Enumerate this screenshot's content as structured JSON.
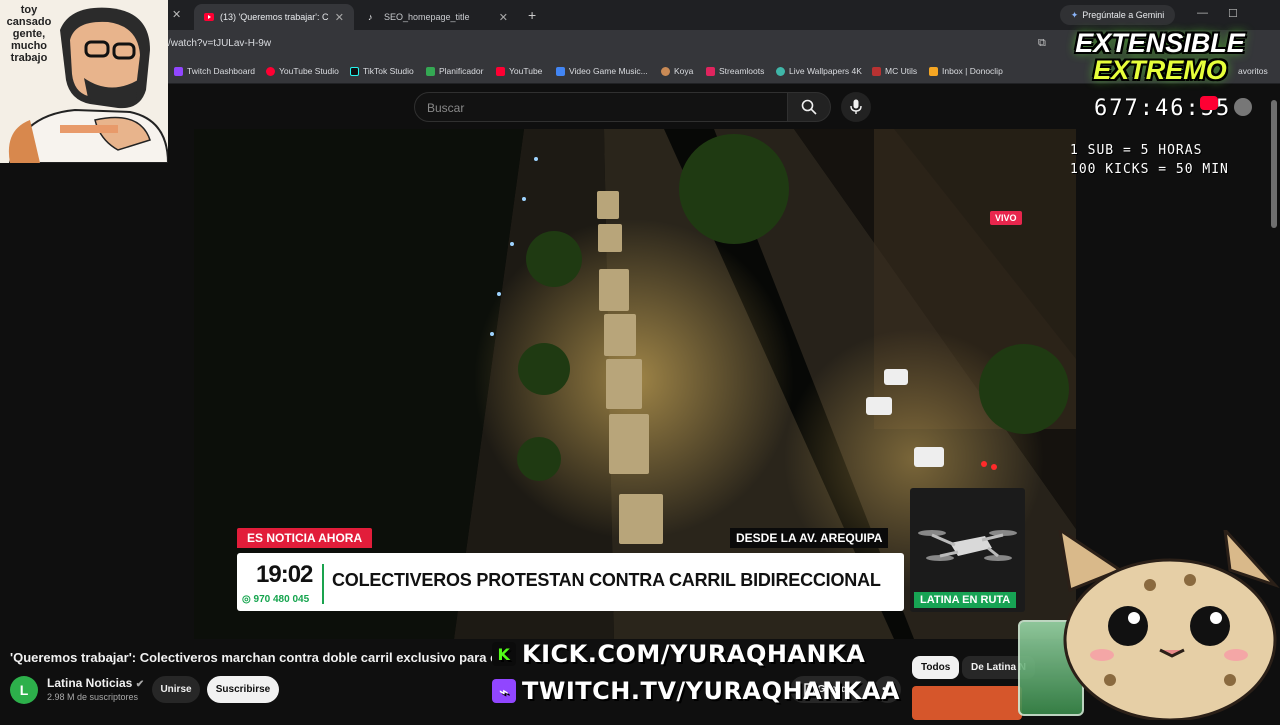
{
  "browser": {
    "tabs": [
      {
        "title": "(13) 'Queremos trabajar': C",
        "active": true
      },
      {
        "title": "SEO_homepage_title",
        "active": false
      }
    ],
    "new_tab": "+",
    "gemini_label": "Pregúntale a Gemini",
    "url": "/watch?v=tJULav-H-9w",
    "bookmarks": [
      "Twitch Dashboard",
      "YouTube Studio",
      "TikTok Studio",
      "Planificador",
      "YouTube",
      "Video Game Music...",
      "Koya",
      "Streamloots",
      "Live Wallpapers 4K",
      "MC Utils",
      "Inbox | Donoclip"
    ],
    "bookmarks_more": "avoritos"
  },
  "youtube": {
    "search_placeholder": "Buscar",
    "video_title": "'Queremos trabajar': Colectiveros marchan contra doble carril exclusivo para c",
    "channel_name": "Latina Noticias",
    "channel_initial": "L",
    "subscribers": "2.98 M de suscriptores",
    "join_label": "Unirse",
    "subscribe_label": "Suscribirse",
    "save_label": "Guardar",
    "more_label": "•••",
    "chips": [
      "Todos",
      "De Latina N"
    ]
  },
  "broadcast": {
    "live_badge": "VIVO",
    "news_tag": "ES NOTICIA AHORA",
    "location_tag": "DESDE LA AV. AREQUIPA",
    "clock": "19:02",
    "phone": "970 480 045",
    "headline": "COLECTIVEROS PROTESTAN CONTRA CARRIL BIDIRECCIONAL",
    "segment_tag": "LATINA EN RUTA"
  },
  "stream_overlay": {
    "webcam_caption": "toy cansado gente, mucho trabajo",
    "event_title_1": "EXTENSIBLE",
    "event_title_2": "EXTREMO",
    "timer": "677:46:55",
    "rule_sub": "1 SUB = 5 HORAS",
    "rule_kicks": "100 KICKS = 50 MIN",
    "kick_url": "KICK.COM/YURAQHANKA",
    "twitch_url": "TWITCH.TV/YURAQHANKAA"
  },
  "colors": {
    "youtube_red": "#ff0033",
    "news_red": "#e21d3a",
    "latina_green": "#17a354",
    "kick_green": "#53fc18",
    "twitch_purple": "#9146ff"
  }
}
